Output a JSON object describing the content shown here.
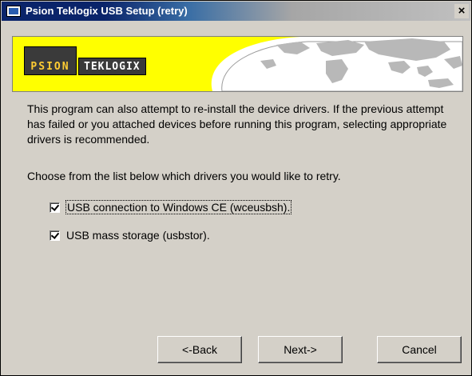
{
  "window": {
    "title": "Psion Teklogix USB Setup (retry)",
    "close_glyph": "×"
  },
  "banner": {
    "logo_word": "PSION",
    "brand_word": "TEKLOGIX",
    "colors": {
      "background": "#ffff00",
      "logo_box": "#3a3a3a",
      "map": "#b8b8b8"
    }
  },
  "content": {
    "paragraph1": "This program can also attempt to re-install the device drivers. If the previous attempt has failed or you attached devices before running this program, selecting appropriate drivers is recommended.",
    "paragraph2": "Choose from the list below which drivers you would like to retry."
  },
  "drivers": [
    {
      "label": "USB connection to Windows CE (wceusbsh).",
      "checked": true
    },
    {
      "label": "USB mass storage (usbstor).",
      "checked": true
    }
  ],
  "buttons": {
    "back": "<-Back",
    "next": "Next->",
    "cancel": "Cancel"
  }
}
